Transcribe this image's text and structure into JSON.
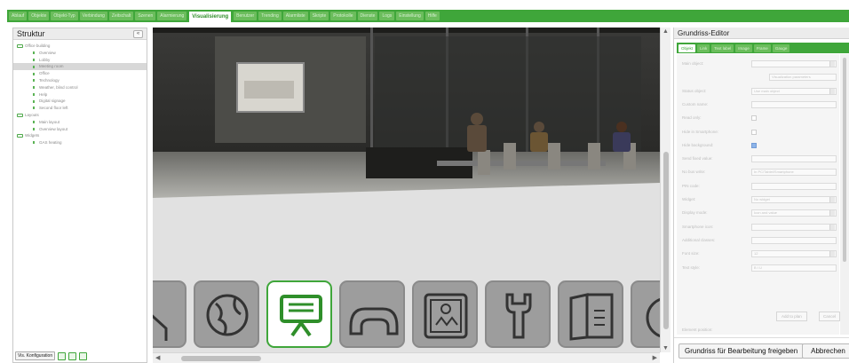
{
  "top_tabs": [
    {
      "label": "Ablauf",
      "active": false
    },
    {
      "label": "Objekte",
      "active": false
    },
    {
      "label": "Objekt-Typ",
      "active": false
    },
    {
      "label": "Verbindung",
      "active": false
    },
    {
      "label": "Zeitschalt",
      "active": false
    },
    {
      "label": "Szenen",
      "active": false
    },
    {
      "label": "Alarmierung",
      "active": false
    },
    {
      "label": "Visualisierung",
      "active": true
    },
    {
      "label": "Benutzer",
      "active": false
    },
    {
      "label": "Trending",
      "active": false
    },
    {
      "label": "Alarmliste",
      "active": false
    },
    {
      "label": "Skripte",
      "active": false
    },
    {
      "label": "Protokolle",
      "active": false
    },
    {
      "label": "Dienste",
      "active": false
    },
    {
      "label": "Logs",
      "active": false
    },
    {
      "label": "Einstellung",
      "active": false
    },
    {
      "label": "Hilfe",
      "active": false
    }
  ],
  "structure": {
    "title": "Struktur",
    "collapse_icon": "double-chevron-left-icon",
    "tree": [
      {
        "label": "Office building",
        "level": 0,
        "kind": "folder",
        "selected": false
      },
      {
        "label": "Overview",
        "level": 1,
        "kind": "leaf",
        "selected": false
      },
      {
        "label": "Lobby",
        "level": 1,
        "kind": "leaf",
        "selected": false
      },
      {
        "label": "Meeting room",
        "level": 1,
        "kind": "leaf",
        "selected": true
      },
      {
        "label": "Office",
        "level": 1,
        "kind": "leaf",
        "selected": false
      },
      {
        "label": "Technology",
        "level": 1,
        "kind": "leaf",
        "selected": false
      },
      {
        "label": "Weather, blind control",
        "level": 1,
        "kind": "leaf",
        "selected": false
      },
      {
        "label": "Help",
        "level": 1,
        "kind": "leaf",
        "selected": false
      },
      {
        "label": "Digital signage",
        "level": 1,
        "kind": "leaf",
        "selected": false
      },
      {
        "label": "Second floor left",
        "level": 1,
        "kind": "leaf",
        "selected": false
      },
      {
        "label": "Layouts",
        "level": 0,
        "kind": "folder",
        "selected": false
      },
      {
        "label": "Main layout",
        "level": 1,
        "kind": "leaf",
        "selected": false
      },
      {
        "label": "Overview layout",
        "level": 1,
        "kind": "leaf",
        "selected": false
      },
      {
        "label": "Widgets",
        "level": 0,
        "kind": "folder",
        "selected": false
      },
      {
        "label": "GAS heating",
        "level": 1,
        "kind": "leaf",
        "selected": false
      }
    ],
    "footer_button": "Vis. Konfiguration",
    "footer_icons": [
      "tree-icon",
      "screen-icon",
      "trash-icon"
    ]
  },
  "canvas": {
    "tiles": [
      {
        "icon": "house-icon",
        "selected": false
      },
      {
        "icon": "globe-icon",
        "selected": false
      },
      {
        "icon": "presentation-icon",
        "selected": true
      },
      {
        "icon": "weather-icon",
        "selected": false
      },
      {
        "icon": "heating-icon",
        "selected": false
      },
      {
        "icon": "wrench-icon",
        "selected": false
      },
      {
        "icon": "book-icon",
        "selected": false
      },
      {
        "icon": "power-icon",
        "selected": false
      }
    ]
  },
  "editor": {
    "title": "Grundriss-Editor",
    "tabs": [
      {
        "label": "Objekt",
        "active": true
      },
      {
        "label": "Link",
        "active": false
      },
      {
        "label": "Text label",
        "active": false
      },
      {
        "label": "Image",
        "active": false
      },
      {
        "label": "Frame",
        "active": false
      },
      {
        "label": "Gauge",
        "active": false
      }
    ],
    "fields": [
      {
        "label": "Main object:",
        "type": "select",
        "value": ""
      },
      {
        "label": "",
        "type": "button",
        "value": "Visualization parameters"
      },
      {
        "label": "Status object:",
        "type": "select",
        "value": "Use main object"
      },
      {
        "label": "Custom name:",
        "type": "text",
        "value": ""
      },
      {
        "label": "Read only:",
        "type": "check",
        "checked": false
      },
      {
        "label": "Hide in Smartphone:",
        "type": "check",
        "checked": false
      },
      {
        "label": "Hide background:",
        "type": "check",
        "checked": true
      },
      {
        "label": "Send fixed value:",
        "type": "text",
        "value": ""
      },
      {
        "label": "No bus write:",
        "type": "checkline",
        "value": "In PC/Tablet/Smartphone"
      },
      {
        "label": "PIN code:",
        "type": "text",
        "value": ""
      },
      {
        "label": "Widget:",
        "type": "select",
        "value": "No widget"
      },
      {
        "label": "Display mode:",
        "type": "select",
        "value": "Icon and value"
      },
      {
        "label": "Smartphone icon:",
        "type": "select",
        "value": ""
      },
      {
        "label": "Additional classes:",
        "type": "text",
        "value": ""
      },
      {
        "label": "Font size:",
        "type": "select",
        "value": "12"
      },
      {
        "label": "Text style:",
        "type": "styles",
        "value": "B  I  U"
      }
    ],
    "add_button": "Add to plan",
    "cancel_button": "Cancel",
    "position_label": "Element position:",
    "size_label": "Element size:",
    "release_button": "Grundriss für Bearbeitung freigeben",
    "abort_button": "Abbrechen"
  }
}
